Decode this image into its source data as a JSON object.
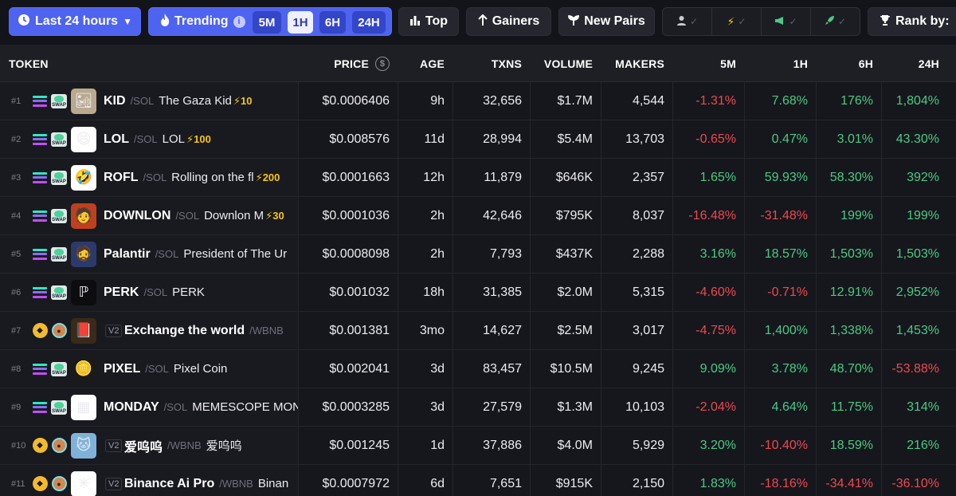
{
  "toolbar": {
    "timeframe": "Last 24 hours",
    "trending": "Trending",
    "trending_info": "i",
    "trend_tfs": [
      {
        "label": "5M",
        "active": false
      },
      {
        "label": "1H",
        "active": true
      },
      {
        "label": "6H",
        "active": false
      },
      {
        "label": "24H",
        "active": false
      }
    ],
    "top": "Top",
    "gainers": "Gainers",
    "new_pairs": "New Pairs",
    "rank_by": "Rank by:",
    "filter_icons": [
      "user-icon",
      "lightning-icon",
      "megaphone-icon",
      "rocket-icon"
    ]
  },
  "columns": {
    "token": "TOKEN",
    "price": "PRICE",
    "price_icon": "$",
    "age": "AGE",
    "txns": "TXNS",
    "volume": "VOLUME",
    "makers": "MAKERS",
    "m5": "5M",
    "h1": "1H",
    "h6": "6H",
    "h24": "24H"
  },
  "rows": [
    {
      "rank": "#1",
      "chain": "sol",
      "dex": "swap",
      "avatar": "🏜",
      "avatar_bg": "#b9a98e",
      "v2": "",
      "symbol": "KID",
      "quote": "/SOL",
      "name": "The Gaza Kid",
      "boost": "⚡10",
      "price": "$0.0006406",
      "age": "9h",
      "txns": "32,656",
      "volume": "$1.7M",
      "makers": "4,544",
      "m5": "-1.31%",
      "h1": "7.68%",
      "h6": "176%",
      "h24": "1,804%"
    },
    {
      "rank": "#2",
      "chain": "sol",
      "dex": "swap",
      "avatar": "😄",
      "avatar_bg": "#ffffff",
      "v2": "",
      "symbol": "LOL",
      "quote": "/SOL",
      "name": "LOL",
      "boost": "⚡100",
      "price": "$0.008576",
      "age": "11d",
      "txns": "28,994",
      "volume": "$5.4M",
      "makers": "13,703",
      "m5": "-0.65%",
      "h1": "0.47%",
      "h6": "3.01%",
      "h24": "43.30%"
    },
    {
      "rank": "#3",
      "chain": "sol",
      "dex": "swap",
      "avatar": "🤣",
      "avatar_bg": "#ffffff",
      "v2": "",
      "symbol": "ROFL",
      "quote": "/SOL",
      "name": "Rolling on the fl",
      "boost": "⚡200",
      "price": "$0.0001663",
      "age": "12h",
      "txns": "11,879",
      "volume": "$646K",
      "makers": "2,357",
      "m5": "1.65%",
      "h1": "59.93%",
      "h6": "58.30%",
      "h24": "392%"
    },
    {
      "rank": "#4",
      "chain": "sol",
      "dex": "swap",
      "avatar": "🧑",
      "avatar_bg": "#c0401e",
      "v2": "",
      "symbol": "DOWNLON",
      "quote": "/SOL",
      "name": "Downlon M",
      "boost": "⚡30",
      "price": "$0.0001036",
      "age": "2h",
      "txns": "42,646",
      "volume": "$795K",
      "makers": "8,037",
      "m5": "-16.48%",
      "h1": "-31.48%",
      "h6": "199%",
      "h24": "199%"
    },
    {
      "rank": "#5",
      "chain": "sol",
      "dex": "swap",
      "avatar": "🧔",
      "avatar_bg": "#2b3a6b",
      "v2": "",
      "symbol": "Palantir",
      "quote": "/SOL",
      "name": "President of The Ur",
      "boost": "",
      "price": "$0.0008098",
      "age": "2h",
      "txns": "7,793",
      "volume": "$437K",
      "makers": "2,288",
      "m5": "3.16%",
      "h1": "18.57%",
      "h6": "1,503%",
      "h24": "1,503%"
    },
    {
      "rank": "#6",
      "chain": "sol",
      "dex": "swap",
      "avatar": "ℙ",
      "avatar_bg": "#0d0d10",
      "v2": "",
      "symbol": "PERK",
      "quote": "/SOL",
      "name": "PERK",
      "boost": "",
      "price": "$0.001032",
      "age": "18h",
      "txns": "31,385",
      "volume": "$2.0M",
      "makers": "5,315",
      "m5": "-4.60%",
      "h1": "-0.71%",
      "h6": "12.91%",
      "h24": "2,952%"
    },
    {
      "rank": "#7",
      "chain": "bnb",
      "dex": "pancake",
      "avatar": "📕",
      "avatar_bg": "#3a2a1a",
      "v2": "V2",
      "symbol": "Exchange the world",
      "quote": "/WBNB",
      "name": "",
      "boost": "",
      "price": "$0.001381",
      "age": "3mo",
      "txns": "14,627",
      "volume": "$2.5M",
      "makers": "3,017",
      "m5": "-4.75%",
      "h1": "1,400%",
      "h6": "1,338%",
      "h24": "1,453%"
    },
    {
      "rank": "#8",
      "chain": "sol",
      "dex": "swap",
      "avatar": "🪙",
      "avatar_bg": "#1a1a1a",
      "v2": "",
      "symbol": "PIXEL",
      "quote": "/SOL",
      "name": "Pixel Coin",
      "boost": "",
      "price": "$0.002041",
      "age": "3d",
      "txns": "83,457",
      "volume": "$10.5M",
      "makers": "9,245",
      "m5": "9.09%",
      "h1": "3.78%",
      "h6": "48.70%",
      "h24": "-53.88%"
    },
    {
      "rank": "#9",
      "chain": "sol",
      "dex": "swap",
      "avatar": "▦",
      "avatar_bg": "#ffffff",
      "v2": "",
      "symbol": "MONDAY",
      "quote": "/SOL",
      "name": "MEMESCOPE MON",
      "boost": "",
      "price": "$0.0003285",
      "age": "3d",
      "txns": "27,579",
      "volume": "$1.3M",
      "makers": "10,103",
      "m5": "-2.04%",
      "h1": "4.64%",
      "h6": "11.75%",
      "h24": "314%"
    },
    {
      "rank": "#10",
      "chain": "bnb",
      "dex": "pancake",
      "avatar": "🐱",
      "avatar_bg": "#7fb2d9",
      "v2": "V2",
      "symbol": "爱呜呜",
      "quote": "/WBNB",
      "name": "爱呜呜",
      "boost": "",
      "price": "$0.001245",
      "age": "1d",
      "txns": "37,886",
      "volume": "$4.0M",
      "makers": "5,929",
      "m5": "3.20%",
      "h1": "-10.40%",
      "h6": "18.59%",
      "h24": "216%"
    },
    {
      "rank": "#11",
      "chain": "bnb",
      "dex": "pancake",
      "avatar": "✳",
      "avatar_bg": "#ffffff",
      "v2": "V2",
      "symbol": "Binance Ai Pro",
      "quote": "/WBNB",
      "name": "Binan",
      "boost": "",
      "price": "$0.0007972",
      "age": "6d",
      "txns": "7,651",
      "volume": "$915K",
      "makers": "2,150",
      "m5": "1.83%",
      "h1": "-18.16%",
      "h6": "-34.41%",
      "h24": "-36.10%"
    }
  ],
  "colors": {
    "positive": "#4cc985",
    "negative": "#ea4a52",
    "accent": "#4e63f0"
  }
}
